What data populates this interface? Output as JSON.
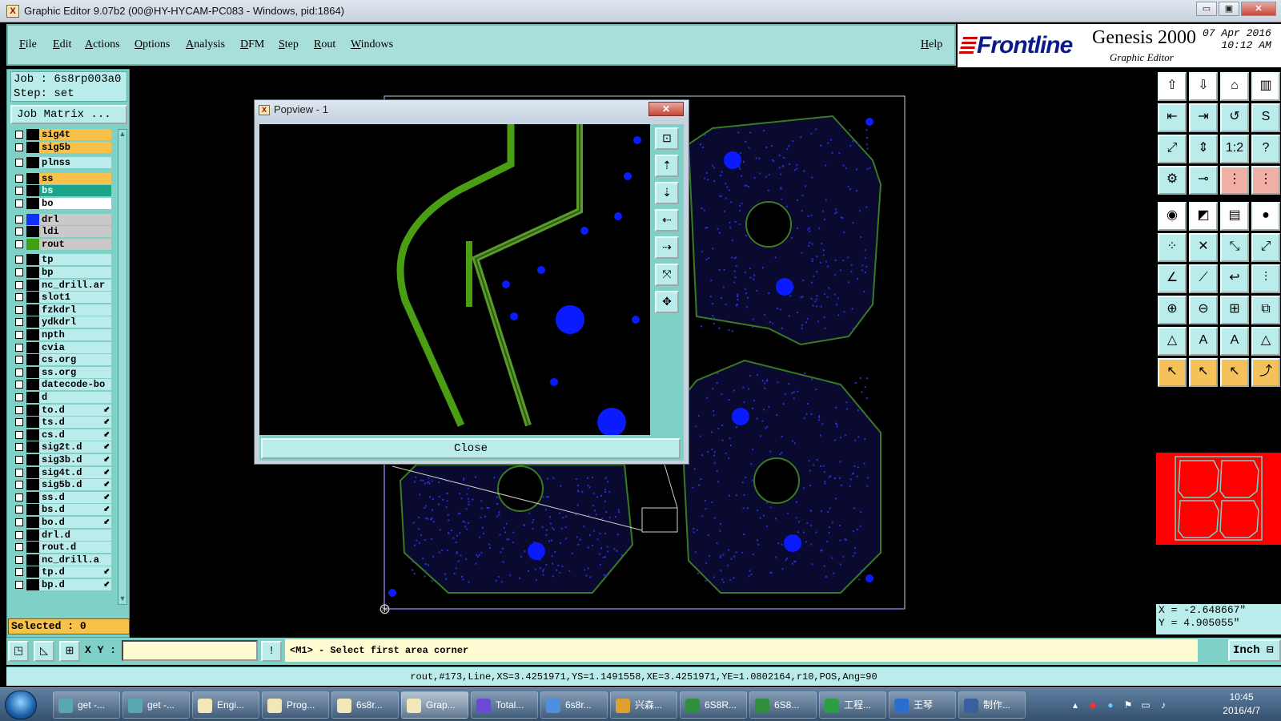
{
  "window": {
    "title": "Graphic Editor 9.07b2 (00@HY-HYCAM-PC083 - Windows, pid:1864)",
    "minimize": "▭",
    "restore": "▣",
    "close": "✕"
  },
  "menu": {
    "items": [
      "File",
      "Edit",
      "Actions",
      "Options",
      "Analysis",
      "DFM",
      "Step",
      "Rout",
      "Windows"
    ],
    "help": "Help"
  },
  "brand": {
    "logo": "Frontline",
    "product": "Genesis 2000",
    "subtitle": "Graphic Editor",
    "date": "07 Apr 2016",
    "time": "10:12 AM"
  },
  "job": {
    "job_line": "Job : 6s8rp003a0",
    "step_line": "Step: set",
    "matrix_button": "Job Matrix ..."
  },
  "layers": [
    {
      "name": "sig4t",
      "color": "#f8c24a",
      "swatch": "#000000"
    },
    {
      "name": "sig5b",
      "color": "#f8c24a",
      "swatch": "#000000"
    },
    {
      "name": "plnss",
      "color": "#b9ecea",
      "swatch": "#000000"
    },
    {
      "name": "ss",
      "color": "#f8c24a",
      "swatch": "#000000"
    },
    {
      "name": "bs",
      "color": "#1aa58a",
      "swatch": "#000000"
    },
    {
      "name": "bo",
      "color": "#ffffff",
      "swatch": "#000000"
    },
    {
      "name": "drl",
      "color": "#c9c9c9",
      "swatch": "#1030ff"
    },
    {
      "name": "ldi",
      "color": "#c9c9c9",
      "swatch": "#000000"
    },
    {
      "name": "rout",
      "color": "#c9c9c9",
      "swatch": "#3fa010"
    },
    {
      "name": "tp",
      "color": "#b9ecea",
      "swatch": "#000000"
    },
    {
      "name": "bp",
      "color": "#b9ecea",
      "swatch": "#000000"
    },
    {
      "name": "nc_drill.ar",
      "color": "#b9ecea",
      "swatch": "#000000"
    },
    {
      "name": "slot1",
      "color": "#b9ecea",
      "swatch": "#000000"
    },
    {
      "name": "fzkdrl",
      "color": "#b9ecea",
      "swatch": "#000000"
    },
    {
      "name": "ydkdrl",
      "color": "#b9ecea",
      "swatch": "#000000"
    },
    {
      "name": "npth",
      "color": "#b9ecea",
      "swatch": "#000000"
    },
    {
      "name": "cvia",
      "color": "#b9ecea",
      "swatch": "#000000"
    },
    {
      "name": "cs.org",
      "color": "#b9ecea",
      "swatch": "#000000"
    },
    {
      "name": "ss.org",
      "color": "#b9ecea",
      "swatch": "#000000"
    },
    {
      "name": "datecode-bo",
      "color": "#b9ecea",
      "swatch": "#000000"
    },
    {
      "name": "d",
      "color": "#b9ecea",
      "swatch": "#000000"
    },
    {
      "name": "to.d",
      "color": "#b9ecea",
      "swatch": "#000000"
    },
    {
      "name": "ts.d",
      "color": "#b9ecea",
      "swatch": "#000000"
    },
    {
      "name": "cs.d",
      "color": "#b9ecea",
      "swatch": "#000000"
    },
    {
      "name": "sig2t.d",
      "color": "#b9ecea",
      "swatch": "#000000"
    },
    {
      "name": "sig3b.d",
      "color": "#b9ecea",
      "swatch": "#000000"
    },
    {
      "name": "sig4t.d",
      "color": "#b9ecea",
      "swatch": "#000000"
    },
    {
      "name": "sig5b.d",
      "color": "#b9ecea",
      "swatch": "#000000"
    },
    {
      "name": "ss.d",
      "color": "#b9ecea",
      "swatch": "#000000"
    },
    {
      "name": "bs.d",
      "color": "#b9ecea",
      "swatch": "#000000"
    },
    {
      "name": "bo.d",
      "color": "#b9ecea",
      "swatch": "#000000"
    },
    {
      "name": "drl.d",
      "color": "#b9ecea",
      "swatch": "#000000"
    },
    {
      "name": "rout.d",
      "color": "#b9ecea",
      "swatch": "#000000"
    },
    {
      "name": "nc_drill.a",
      "color": "#b9ecea",
      "swatch": "#000000"
    },
    {
      "name": "tp.d",
      "color": "#b9ecea",
      "swatch": "#000000"
    },
    {
      "name": "bp.d",
      "color": "#b9ecea",
      "swatch": "#000000"
    }
  ],
  "selected": "Selected : 0",
  "popview": {
    "title": "Popview - 1",
    "close_label": "Close",
    "close_x": "✕"
  },
  "coords": {
    "x": "X = -2.648667\"",
    "y": "Y = 4.905055\""
  },
  "command": {
    "xy_label": "X Y :",
    "xy_value": "",
    "prompt": "<M1> - Select first area corner",
    "unit": "Inch ⊟",
    "status": "rout,#173,Line,XS=3.4251971,YS=1.1491558,XE=3.4251971,YE=1.0802164,r10,POS,Ang=90"
  },
  "taskbar": {
    "items": [
      {
        "label": "get -...",
        "color": "#5aa9b0"
      },
      {
        "label": "get -...",
        "color": "#5aa9b0"
      },
      {
        "label": "Engi...",
        "color": "#f2e7b8"
      },
      {
        "label": "Prog...",
        "color": "#f2e7b8"
      },
      {
        "label": "6s8r...",
        "color": "#f2e7b8"
      },
      {
        "label": "Grap...",
        "color": "#f2e7b8"
      },
      {
        "label": "Total...",
        "color": "#6b4bd6"
      },
      {
        "label": "6s8r...",
        "color": "#4e8fe0"
      },
      {
        "label": "兴森...",
        "color": "#e0a030"
      },
      {
        "label": "6S8R...",
        "color": "#2f8f3f"
      },
      {
        "label": "6S8...",
        "color": "#2f8f3f"
      },
      {
        "label": "工程...",
        "color": "#2aa040"
      },
      {
        "label": "王琴",
        "color": "#2a6fd0"
      },
      {
        "label": "制作...",
        "color": "#3a5fa0"
      }
    ],
    "time": "10:45",
    "date": "2016/4/7"
  }
}
